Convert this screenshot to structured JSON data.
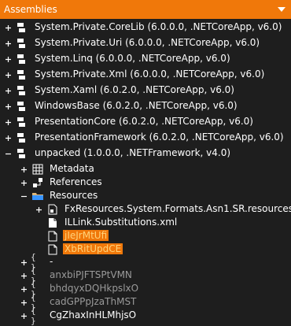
{
  "panel": {
    "title": "Assemblies"
  },
  "items": [
    {
      "label": "System.Private.CoreLib (6.0.0.0, .NETCoreApp, v6.0)"
    },
    {
      "label": "System.Private.Uri (6.0.0.0, .NETCoreApp, v6.0)"
    },
    {
      "label": "System.Linq (6.0.0.0, .NETCoreApp, v6.0)"
    },
    {
      "label": "System.Private.Xml (6.0.0.0, .NETCoreApp, v6.0)"
    },
    {
      "label": "System.Xaml (6.0.2.0, .NETCoreApp, v6.0)"
    },
    {
      "label": "WindowsBase (6.0.2.0, .NETCoreApp, v6.0)"
    },
    {
      "label": "PresentationCore (6.0.2.0, .NETCoreApp, v6.0)"
    },
    {
      "label": "PresentationFramework (6.0.2.0, .NETCoreApp, v6.0)"
    },
    {
      "label": "unpacked (1.0.0.0, .NETFramework, v4.0)"
    },
    {
      "label": "Metadata"
    },
    {
      "label": "References"
    },
    {
      "label": "Resources"
    },
    {
      "label": "FxResources.System.Formats.Asn1.SR.resources"
    },
    {
      "label": "ILLink.Substitutions.xml"
    },
    {
      "label": "jIeJrMtUfi"
    },
    {
      "label": "XbRitUpdCE"
    },
    {
      "label": "-"
    },
    {
      "label": "anxbiPJFTSPtVMN"
    },
    {
      "label": "bhdqyxDQHkpslxO"
    },
    {
      "label": "cadGPPpJzaThMST"
    },
    {
      "label": "CgZhaxInHLMhjsO"
    }
  ],
  "colors": {
    "accent": "#f0780a",
    "background": "#1e1e1e",
    "highlight_text": "#ffd27a",
    "dim_text": "#9a9a9a"
  },
  "icons": {
    "namespace": "braces-icon",
    "assembly": "assembly-icon",
    "folder": "folder-icon",
    "file": "file-icon"
  }
}
